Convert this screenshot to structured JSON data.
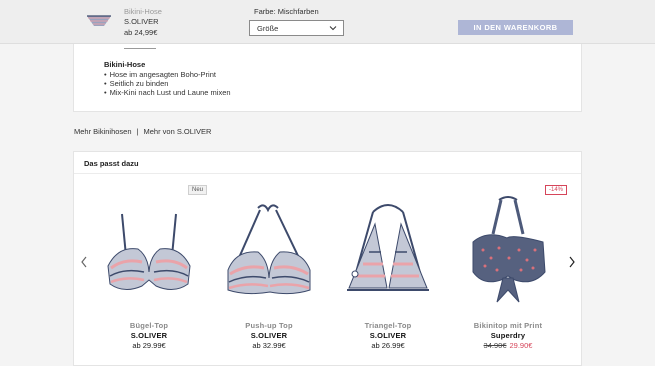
{
  "sticky_bar": {
    "product_type": "Bikini-Hose",
    "brand": "S.OLIVER",
    "price": "ab 24,99€",
    "color_label": "Farbe: Mischfarben",
    "size_select": "Größe",
    "cart_button": "IN DEN WARENKORB"
  },
  "description": {
    "title": "Bikini-Hose",
    "bullets": [
      "Hose im angesagten Boho-Print",
      "Seitlich zu binden",
      "Mix-Kini nach Lust und Laune mixen"
    ]
  },
  "links": {
    "more_category": "Mehr Bikinihosen",
    "separator": "|",
    "more_brand": "Mehr von S.OLIVER"
  },
  "recommendations": {
    "title": "Das passt dazu",
    "products": [
      {
        "badge": "Neu",
        "type": "Bügel-Top",
        "brand": "S.OLIVER",
        "price": "ab 29.99€"
      },
      {
        "type": "Push-up Top",
        "brand": "S.OLIVER",
        "price": "ab 32.99€"
      },
      {
        "type": "Triangel-Top",
        "brand": "S.OLIVER",
        "price": "ab 26.99€"
      },
      {
        "badge": "-14%",
        "type": "Bikinitop mit Print",
        "brand": "Superdry",
        "old_price": "34.90€",
        "new_price": "29.90€"
      }
    ]
  },
  "colors": {
    "cart_button": "#aeb6d6",
    "sale": "#d6455a",
    "navy": "#3d4a6b",
    "pink": "#eaa3a9"
  }
}
